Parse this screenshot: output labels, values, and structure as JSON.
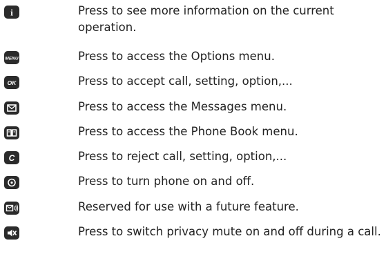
{
  "keys": [
    {
      "icon": "info-key-icon",
      "glyph": "i",
      "desc": "Press to see more information on the current operation."
    },
    {
      "icon": "menu-key-icon",
      "glyph": "MENU",
      "desc": "Press to access the Options menu."
    },
    {
      "icon": "ok-key-icon",
      "glyph": "OK",
      "desc": "Press to accept call, setting, option,..."
    },
    {
      "icon": "envelope-key-icon",
      "desc": "Press to access the Messages menu."
    },
    {
      "icon": "phonebook-key-icon",
      "desc": "Press to access the Phone Book menu."
    },
    {
      "icon": "clear-key-icon",
      "glyph": "C",
      "desc": "Press to reject call, setting, option,..."
    },
    {
      "icon": "power-key-icon",
      "desc": "Press to turn phone on and off."
    },
    {
      "icon": "voice-message-key-icon",
      "desc": "Reserved for use with a future feature."
    },
    {
      "icon": "mute-key-icon",
      "desc": "Press to switch privacy mute on and off during a call."
    }
  ],
  "colors": {
    "key_fill": "#2b2b2b",
    "key_glyph": "#ffffff",
    "text": "#222222"
  }
}
